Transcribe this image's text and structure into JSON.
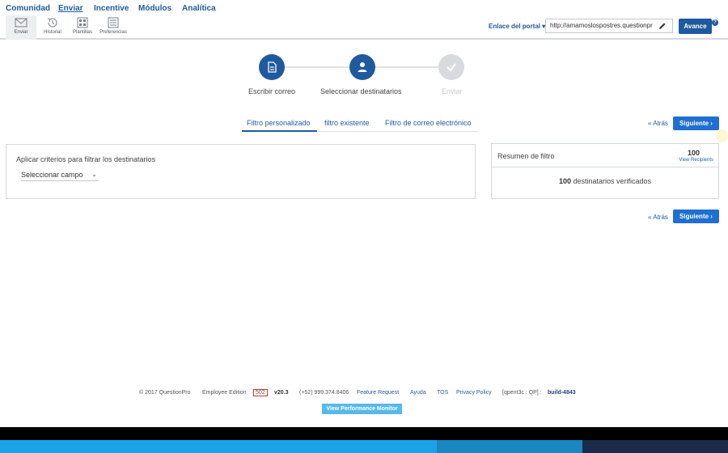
{
  "topnav": {
    "items": [
      {
        "label": "Comunidad"
      },
      {
        "label": "Enviar"
      },
      {
        "label": "Incentive"
      },
      {
        "label": "Módulos"
      },
      {
        "label": "Analítica"
      }
    ]
  },
  "toolbar": {
    "tools": [
      {
        "label": "Enviar",
        "icon": "envelope-icon"
      },
      {
        "label": "Historial",
        "icon": "history-icon"
      },
      {
        "label": "Plantillas",
        "icon": "templates-icon"
      },
      {
        "label": "Preferencias",
        "icon": "preferences-icon"
      }
    ],
    "portal_label": "Enlace del portal ▾",
    "portal_url": "http://amamoslospostres.questionpr",
    "avance_label": "Avance",
    "help_glyph": "?"
  },
  "steps": [
    {
      "label": "Escribir correo",
      "state": "done",
      "icon": "document-icon"
    },
    {
      "label": "Seleccionar destinatarios",
      "state": "current",
      "icon": "user-icon"
    },
    {
      "label": "Enviar",
      "state": "pending",
      "icon": "check-icon"
    }
  ],
  "filter_tabs": [
    {
      "label": "Filtro personalizado",
      "active": true
    },
    {
      "label": "filtro existente",
      "active": false
    },
    {
      "label": "Filtro de correo electrónico",
      "active": false
    }
  ],
  "pager": {
    "back_label": "« Atrás",
    "next_label": "Siguiente ›"
  },
  "criteria": {
    "title": "Aplicar criterios para filtrar los destinatarios",
    "select_value": "Seleccionar campo",
    "select_chevron": "⌄"
  },
  "summary": {
    "title": "Resumen de filtro",
    "count": "100",
    "view_recipients": "View Recipients",
    "verified_count": "100",
    "verified_text": "destinatarios verificados"
  },
  "footer": {
    "copyright": "© 2017 QuestionPro",
    "edition": "Employee Edition",
    "server": "502",
    "version": "v20.3",
    "phone": "(+52) 999.374.8406",
    "feature_request": "Feature Request",
    "help": "Ayuda",
    "tos": "TOS",
    "privacy": "Privacy Policy",
    "instance": "[qpent3c : QP] :",
    "build": "build-4843",
    "perf_button": "View Performance Monitor"
  },
  "colors": {
    "brand_blue": "#1f5a9e",
    "button_blue": "#1f6fd0",
    "perf_button": "#57b9e8",
    "footer_bar_light": "#1aa3e8",
    "footer_bar_mid": "#1a86c2",
    "footer_bar_dark": "#1c2a4a"
  }
}
